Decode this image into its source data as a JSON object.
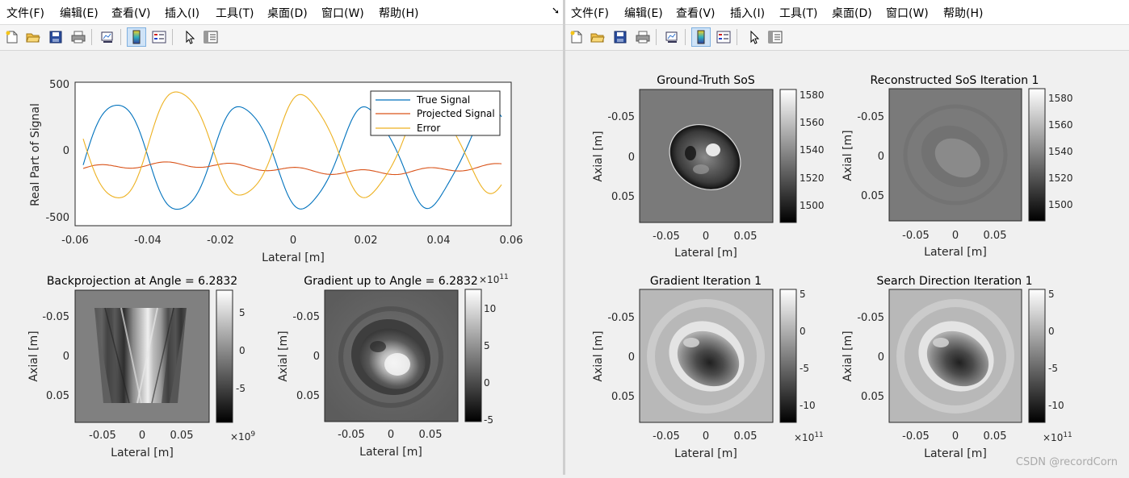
{
  "menus": [
    "文件(F)",
    "编辑(E)",
    "查看(V)",
    "插入(I)",
    "工具(T)",
    "桌面(D)",
    "窗口(W)",
    "帮助(H)"
  ],
  "toolbar_icons": [
    "new-figure-icon",
    "open-file-icon",
    "save-icon",
    "print-icon",
    "link-plot-icon",
    "insert-colorbar-icon",
    "insert-legend-icon",
    "pointer-icon",
    "property-inspector-icon"
  ],
  "watermark": "CSDN @recordCorn",
  "colors": {
    "true_signal": "#0072bd",
    "projected_signal": "#d95319",
    "error": "#edb120"
  },
  "left": {
    "signal_plot": {
      "ylabel": "Real Part of Signal",
      "xlabel": "Lateral [m]",
      "xticks": [
        "-0.06",
        "-0.04",
        "-0.02",
        "0",
        "0.02",
        "0.04",
        "0.06"
      ],
      "yticks": [
        "500",
        "0",
        "-500"
      ],
      "legend": [
        "True Signal",
        "Projected Signal",
        "Error"
      ]
    },
    "backprojection": {
      "title": "Backprojection at Angle = 6.2832",
      "xlabel": "Lateral [m]",
      "ylabel": "Axial [m]",
      "xticks": [
        "-0.05",
        "0",
        "0.05"
      ],
      "yticks": [
        "-0.05",
        "0",
        "0.05"
      ],
      "cbar_ticks": [
        "5",
        "0",
        "-5"
      ],
      "cbar_exp": "×10",
      "cbar_exp_sup": "9"
    },
    "gradient": {
      "title": "Gradient up to Angle = 6.2832",
      "xlabel": "Lateral [m]",
      "ylabel": "Axial [m]",
      "xticks": [
        "-0.05",
        "0",
        "0.05"
      ],
      "yticks": [
        "-0.05",
        "0",
        "0.05"
      ],
      "cbar_ticks": [
        "10",
        "5",
        "0",
        "-5"
      ],
      "cbar_exp": "×10",
      "cbar_exp_sup": "11"
    }
  },
  "right": {
    "ground_truth": {
      "title": "Ground-Truth SoS",
      "xlabel": "Lateral [m]",
      "ylabel": "Axial [m]",
      "xticks": [
        "-0.05",
        "0",
        "0.05"
      ],
      "yticks": [
        "-0.05",
        "0",
        "0.05"
      ],
      "cbar_ticks": [
        "1580",
        "1560",
        "1540",
        "1520",
        "1500"
      ]
    },
    "reconstructed": {
      "title": "Reconstructed SoS Iteration 1",
      "xlabel": "Lateral [m]",
      "ylabel": "Axial [m]",
      "xticks": [
        "-0.05",
        "0",
        "0.05"
      ],
      "yticks": [
        "-0.05",
        "0",
        "0.05"
      ],
      "cbar_ticks": [
        "1580",
        "1560",
        "1540",
        "1520",
        "1500"
      ]
    },
    "gradient_iter": {
      "title": "Gradient Iteration 1",
      "xlabel": "Lateral [m]",
      "ylabel": "Axial [m]",
      "xticks": [
        "-0.05",
        "0",
        "0.05"
      ],
      "yticks": [
        "-0.05",
        "0",
        "0.05"
      ],
      "cbar_ticks": [
        "5",
        "0",
        "-5",
        "-10"
      ],
      "cbar_exp": "×10",
      "cbar_exp_sup": "11"
    },
    "search_direction": {
      "title": "Search Direction Iteration 1",
      "xlabel": "Lateral [m]",
      "ylabel": "Axial [m]",
      "xticks": [
        "-0.05",
        "0",
        "0.05"
      ],
      "yticks": [
        "-0.05",
        "0",
        "0.05"
      ],
      "cbar_ticks": [
        "5",
        "0",
        "-5",
        "-10"
      ],
      "cbar_exp": "×10",
      "cbar_exp_sup": "11"
    }
  }
}
